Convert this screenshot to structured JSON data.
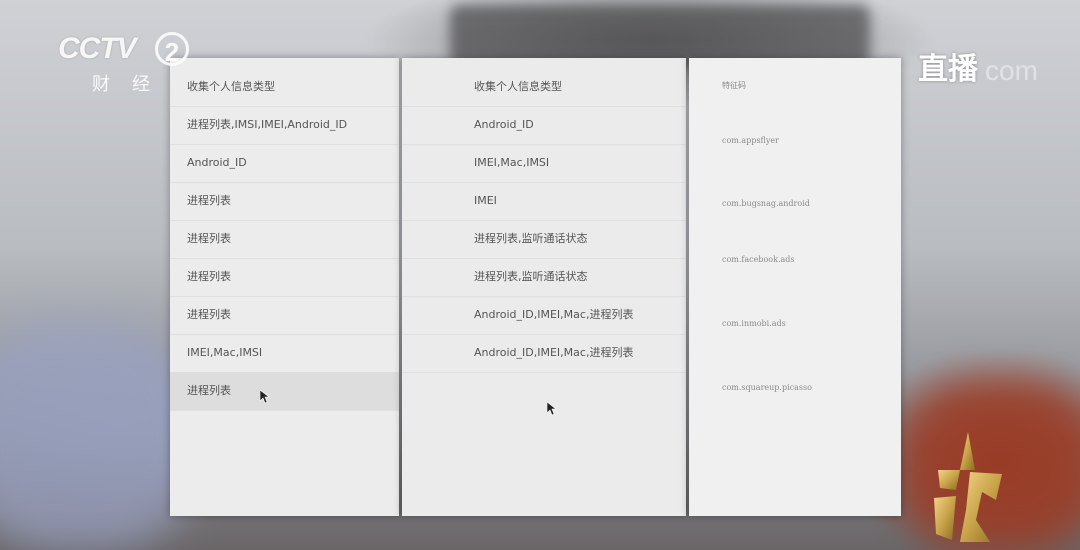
{
  "broadcast": {
    "channel_logo": "CCTV",
    "channel_number": "2",
    "channel_sub": "财经",
    "live_label": "直播",
    "watermark": "com",
    "badge_digits": "315"
  },
  "panels": {
    "left": {
      "header": "收集个人信息类型",
      "rows": [
        "进程列表,IMSI,IMEI,Android_ID",
        "Android_ID",
        "进程列表",
        "进程列表",
        "进程列表",
        "进程列表",
        "IMEI,Mac,IMSI",
        "进程列表"
      ]
    },
    "middle": {
      "header": "收集个人信息类型",
      "rows": [
        "Android_ID",
        "IMEI,Mac,IMSI",
        "IMEI",
        "进程列表,监听通话状态",
        "进程列表,监听通话状态",
        "Android_ID,IMEI,Mac,进程列表",
        "Android_ID,IMEI,Mac,进程列表"
      ]
    },
    "right": {
      "header": "特征码",
      "rows": [
        "com.appsflyer",
        "com.bugsnag.android",
        "com.facebook.ads",
        "com.inmobi.ads",
        "com.squareup.picasso"
      ]
    }
  },
  "colors": {
    "panel_bg": "#ececec",
    "badge_gold": "#c9a44a"
  }
}
